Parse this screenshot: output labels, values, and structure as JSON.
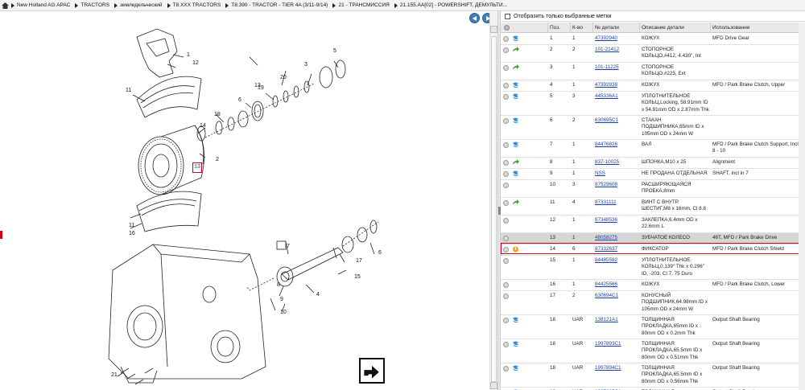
{
  "breadcrumb": {
    "items": [
      "New Holland AG APAC",
      "TRACTORS",
      "земледельческий",
      "T8.XXX TRACTORS",
      "T8.390 - TRACTOR - TIER 4A (3/11-9/14)",
      "21 - ТРАНСМИССИЯ",
      "21.155.AA[02] - POWERSHIFT, ДЕМУЛЬТИ..."
    ]
  },
  "diagram": {
    "callouts": [
      "1",
      "12",
      "11",
      "5",
      "19",
      "20",
      "3",
      "6",
      "13",
      "18",
      "14",
      "2",
      "11",
      "16",
      "7",
      "17",
      "6",
      "15",
      "4",
      "8",
      "9",
      "10",
      "21"
    ],
    "highlighted_callout": "13"
  },
  "filter": {
    "label": "Отобразить только выбранные метки"
  },
  "columns": [
    "Поз.",
    "К-во",
    "№ детали",
    "Описание детали",
    "Использование"
  ],
  "parts": [
    {
      "pos": "1",
      "qty": "1",
      "num": "47392940",
      "desc": "КОЖУХ",
      "use": "MFD Drive Gear",
      "action": "blue",
      "h": 14
    },
    {
      "pos": "2",
      "qty": "2",
      "num": "101-21412",
      "desc": "СТОПОРНОЕ КОЛЬЦО,#412, 4.430\", Int",
      "use": "",
      "action": "green",
      "h": 22
    },
    {
      "pos": "3",
      "qty": "1",
      "num": "101-11225",
      "desc": "СТОПОРНОЕ КОЛЬЦО,#225, Ext",
      "use": "",
      "action": "green",
      "h": 22
    },
    {
      "pos": "4",
      "qty": "1",
      "num": "47392938",
      "desc": "КОЖУХ",
      "use": "MFD / Park Brake Clutch, Upper",
      "action": "blue",
      "h": 14
    },
    {
      "pos": "5",
      "qty": "3",
      "num": "445336A1",
      "desc": "УПЛОТНИТЕЛЬНОЕ КОЛЬЦ,Locking, 58.91mm ID x 54.91mm OD x 2.87mm Thk",
      "use": "",
      "action": "blue",
      "h": 30
    },
    {
      "pos": "6",
      "qty": "2",
      "num": "630695C1",
      "desc": "СТАКАН ПОДШИПНИКА,65mm ID x 105mm OD x 24mm W",
      "use": "",
      "action": "blue",
      "h": 30
    },
    {
      "pos": "7",
      "qty": "1",
      "num": "84476828",
      "desc": "ВАЛ",
      "use": "MFD / Park Brake Clutch Support, Incl 8 - 10",
      "action": "blue",
      "h": 22
    },
    {
      "pos": "8",
      "qty": "1",
      "num": "837-10025",
      "desc": "ШПОНКА,M10 x 25",
      "use": "Alignment",
      "action": "green",
      "h": 14
    },
    {
      "pos": "9",
      "qty": "1",
      "num": "NSS",
      "desc": "НЕ ПРОДАНА ОТДЕЛЬНАЯ",
      "use": "SHAFT, incl in 7",
      "action": "blue",
      "h": 14
    },
    {
      "pos": "10",
      "qty": "3",
      "num": "87529608",
      "desc": "РАСШИРЯЮЩАЯСЯ ПРОБКА,8mm",
      "use": "",
      "action": "none",
      "h": 22
    },
    {
      "pos": "11",
      "qty": "4",
      "num": "87331111",
      "desc": "ВИНТ С ВНУТР. ШЕСТИГ,M8 x 16mm, Cl 8.8",
      "use": "",
      "action": "green",
      "h": 22
    },
    {
      "pos": "12",
      "qty": "1",
      "num": "87348536",
      "desc": "ЗАКЛЕПКА,6.4mm OD x 22.6mm L",
      "use": "",
      "action": "none",
      "h": 22
    },
    {
      "pos": "13",
      "qty": "1",
      "num": "48058275",
      "desc": "ЗУБЧАТОЕ КОЛЕСО",
      "use": "46T, MFD / Park Brake Drive",
      "action": "none",
      "h": 14,
      "selected": true
    },
    {
      "pos": "14",
      "qty": "6",
      "num": "87332637",
      "desc": "ФИКСАТОР",
      "use": "MFD / Park Brake Clutch Shield",
      "action": "orange",
      "h": 14
    },
    {
      "pos": "15",
      "qty": "1",
      "num": "84485582",
      "desc": "УПЛОТНИТЕЛЬНОЕ КОЛЬЦ,0.139\" Thk x 0.296\" ID, -203, Cl 7, 75 Duro",
      "use": "",
      "action": "none",
      "h": 30
    },
    {
      "pos": "16",
      "qty": "1",
      "num": "84425566",
      "desc": "КОЖУХ",
      "use": "MFD / Park Brake Clutch, Lower",
      "action": "none",
      "h": 14
    },
    {
      "pos": "17",
      "qty": "2",
      "num": "630694C1",
      "desc": "КОНУСНЫЙ ПОДШИПНИК,64.98mm ID x 105mm OD x 24mm W",
      "use": "",
      "action": "none",
      "h": 30
    },
    {
      "pos": "18",
      "qty": "UAR",
      "num": "138121A1",
      "desc": "ТОЛЩИННАЯ ПРОКЛАДКА,65mm ID x 80mm OD x 0.2mm Thk",
      "use": "Output Shaft Bearing",
      "action": "blue",
      "h": 30
    },
    {
      "pos": "18",
      "qty": "UAR",
      "num": "1997893C1",
      "desc": "ТОЛЩИННАЯ ПРОКЛАДКА,65.5mm ID x 80mm OD x 0.51mm Thk",
      "use": "Output Shaft Bearing",
      "action": "blue",
      "h": 30
    },
    {
      "pos": "18",
      "qty": "UAR",
      "num": "1997894C1",
      "desc": "ТОЛЩИННАЯ ПРОКЛАДКА,65.5mm ID x 80mm OD x 0.56mm Thk",
      "use": "Output Shaft Bearing",
      "action": "blue",
      "h": 30
    },
    {
      "pos": "18",
      "qty": "UAR",
      "num": "1997895C1",
      "desc": "ТОЛЩИННАЯ",
      "use": "Output Shaft Bearing",
      "action": "blue",
      "h": 14
    }
  ],
  "colors": {
    "link": "#1a3fb0",
    "highlight": "#d0021b",
    "selected_row": "#d6d6d6"
  }
}
